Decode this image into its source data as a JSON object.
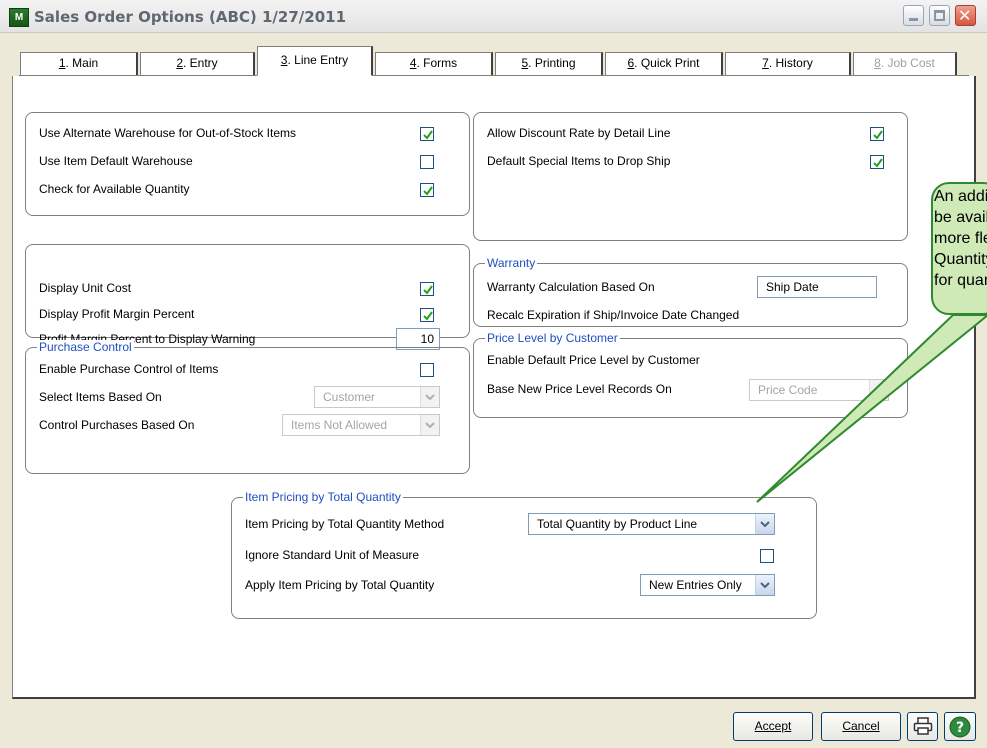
{
  "window": {
    "title": "Sales Order Options (ABC) 1/27/2011",
    "icon_text": "M"
  },
  "tabs": [
    {
      "key": "1",
      "label": ". Main",
      "active": false
    },
    {
      "key": "2",
      "label": ". Entry",
      "active": false
    },
    {
      "key": "3",
      "label": ". Line Entry",
      "active": true
    },
    {
      "key": "4",
      "label": ". Forms",
      "active": false
    },
    {
      "key": "5",
      "label": ". Printing",
      "active": false
    },
    {
      "key": "6",
      "label": ". Quick Print",
      "active": false
    },
    {
      "key": "7",
      "label": ". History",
      "active": false
    },
    {
      "key": "8",
      "label": ". Job Cost",
      "disabled": true
    }
  ],
  "warehouse": {
    "rows": [
      {
        "label": "Use Alternate Warehouse for Out-of-Stock Items",
        "checked": true
      },
      {
        "label": "Use Item Default Warehouse",
        "checked": false
      },
      {
        "label": "Check for Available Quantity",
        "checked": true
      }
    ]
  },
  "discount": {
    "rows": [
      {
        "label": "Allow Discount Rate by Detail Line",
        "checked": true
      },
      {
        "label": "Default Special Items to Drop Ship",
        "checked": true
      }
    ]
  },
  "cost": {
    "display_unit_cost": {
      "label": "Display Unit Cost",
      "checked": true
    },
    "display_profit_margin": {
      "label": "Display Profit Margin Percent",
      "checked": true
    },
    "profit_warning": {
      "label": "Profit Margin Percent to Display Warning",
      "value": "10"
    }
  },
  "warranty": {
    "legend": "Warranty",
    "calc_label": "Warranty Calculation Based On",
    "calc_value": "Ship Date",
    "recalc_label": "Recalc Expiration if Ship/Invoice Date Changed"
  },
  "price_level": {
    "legend": "Price Level by Customer",
    "enable_label": "Enable Default Price Level by Customer",
    "base_label": "Base New Price Level Records On",
    "base_value": "Price Code"
  },
  "purchase": {
    "legend": "Purchase Control",
    "enable_label": "Enable Purchase Control of Items",
    "enable_checked": false,
    "select_label": "Select Items Based On",
    "select_value": "Customer",
    "control_label": "Control Purchases Based On",
    "control_value": "Items Not Allowed"
  },
  "item_pricing": {
    "legend": "Item Pricing by Total Quantity",
    "method_label": "Item Pricing by Total Quantity Method",
    "method_value": "Total Quantity by Product Line",
    "ignore_label": "Ignore Standard Unit of Measure",
    "ignore_checked": false,
    "apply_label": "Apply Item Pricing by Total Quantity",
    "apply_value": "New Entries Only"
  },
  "buttons": {
    "accept": "Accept",
    "cancel": "Cancel"
  },
  "callout": {
    "text": "An addit\nbe availa\nmore fle\nQuantity\nfor quan"
  },
  "colors": {
    "check": "#21a121",
    "legend": "#1f4fbf",
    "callout_fill": "#cfe9b7",
    "callout_border": "#2f8a2f"
  }
}
